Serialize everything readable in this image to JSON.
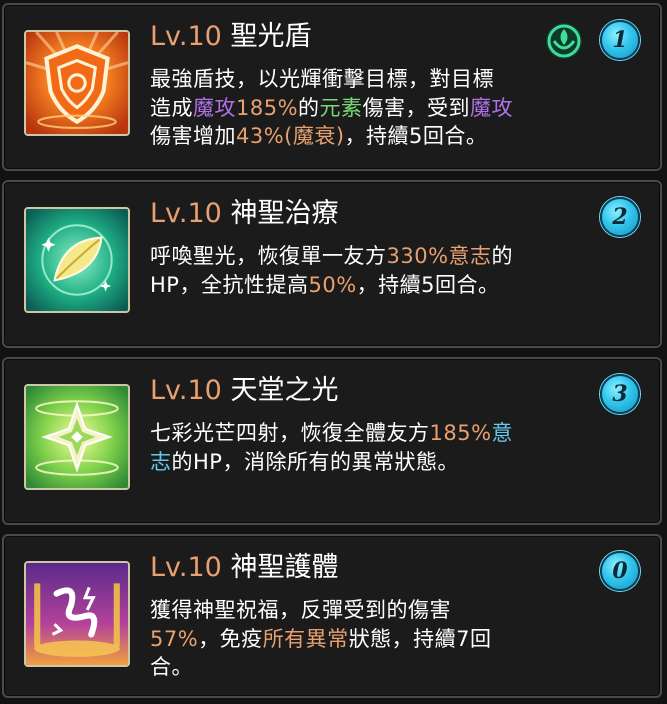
{
  "colors": {
    "level": "#e8a070",
    "highlight_orange": "#e8a070",
    "highlight_purple": "#b071e6",
    "highlight_green": "#78d878",
    "highlight_blue": "#66c8ee",
    "badge": "#32c6ec"
  },
  "skills": [
    {
      "level": "Lv.10",
      "name": "聖光盾",
      "icon": "shield-emblem-icon",
      "element_icon": "wood-element-icon",
      "badge": "1",
      "desc": {
        "line1": "最強盾技，以光輝衝擊目標，對目標",
        "l2_a": "造成",
        "l2_b": "魔攻",
        "l2_c": "185%",
        "l2_d": "的",
        "l2_e": "元素",
        "l2_f": "傷害，受到",
        "l2_g": "魔攻",
        "l3_a": "傷害增加",
        "l3_b": "43%(魔衰)",
        "l3_c": "，持續5回合。"
      }
    },
    {
      "level": "Lv.10",
      "name": "神聖治療",
      "icon": "leaf-heal-icon",
      "badge": "2",
      "desc": {
        "l1_a": "呼喚聖光，恢復單一友方",
        "l1_b": "330%",
        "l1_c": "意志",
        "l1_d": "的",
        "l2_a": "HP，全抗性提高",
        "l2_b": "50%",
        "l2_c": "，持續5回合。"
      }
    },
    {
      "level": "Lv.10",
      "name": "天堂之光",
      "icon": "radiant-star-icon",
      "badge": "3",
      "desc": {
        "l1_a": "七彩光芒四射，恢復全體友方",
        "l1_b": "185%",
        "l1_c": "意",
        "l2_a": "志",
        "l2_b": "的HP，消除所有的異常狀態。"
      }
    },
    {
      "level": "Lv.10",
      "name": "神聖護體",
      "icon": "holy-ward-icon",
      "badge": "0",
      "desc": {
        "line1": "獲得神聖祝福，反彈受到的傷害",
        "l2_a": "57%",
        "l2_b": "，免疫",
        "l2_c": "所有異常",
        "l2_d": "狀態，持續7回",
        "line3": "合。"
      }
    }
  ]
}
